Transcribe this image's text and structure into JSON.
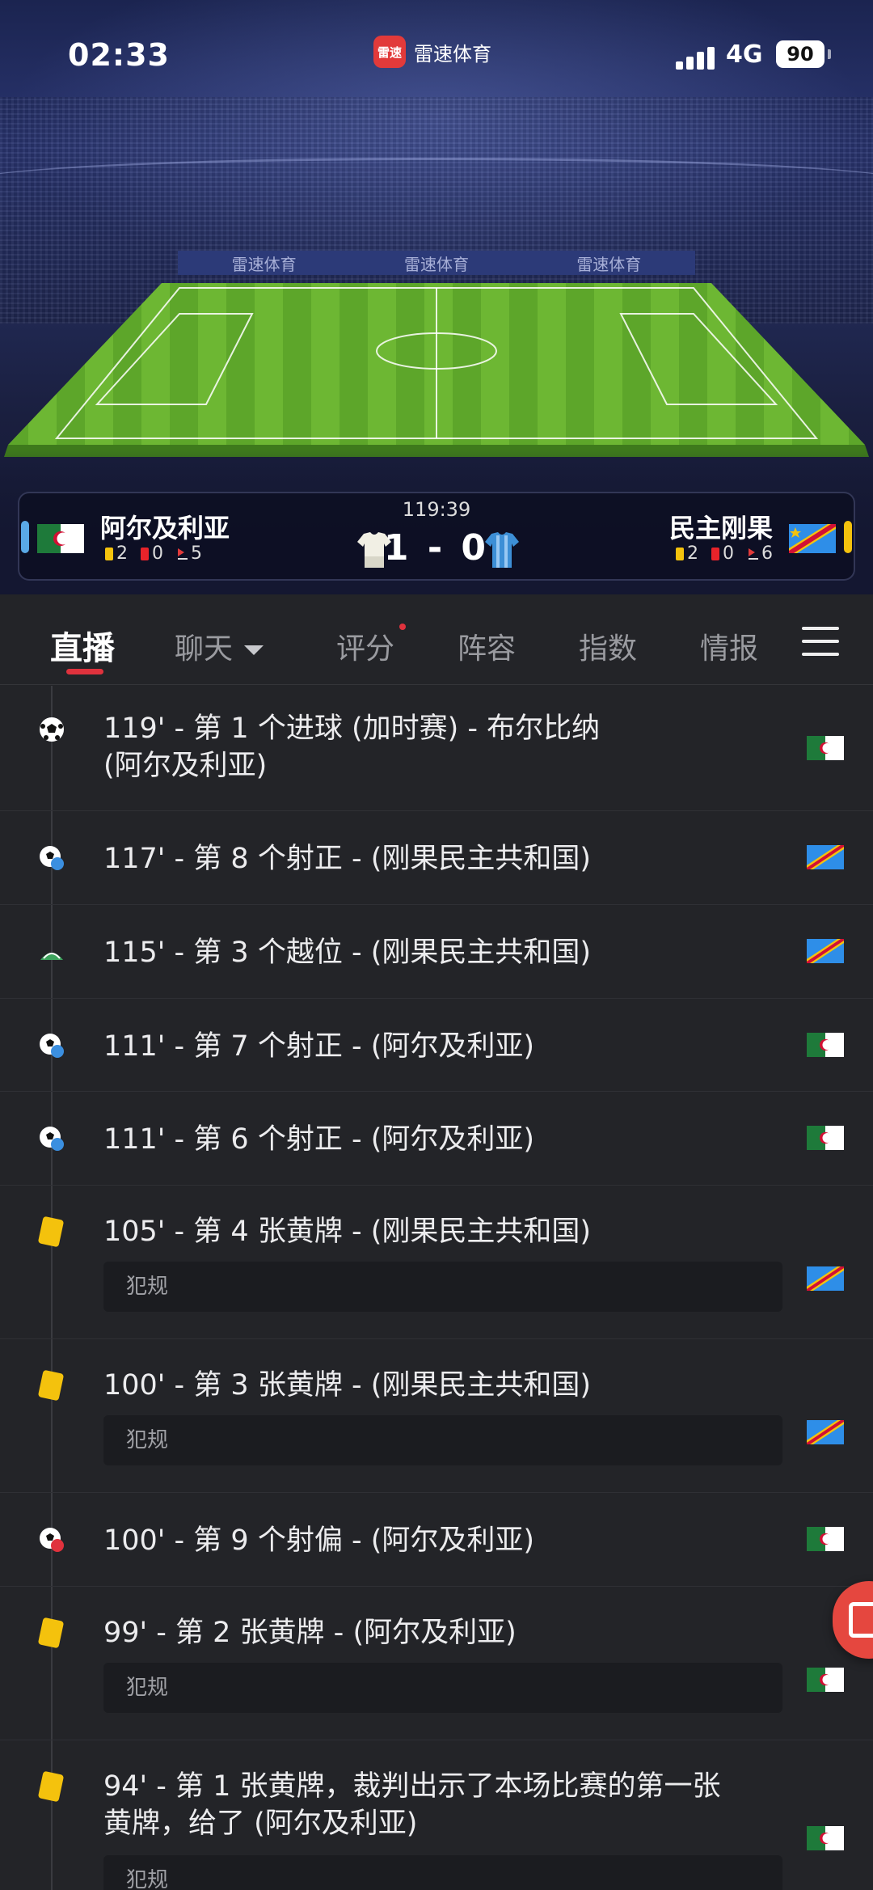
{
  "status_bar": {
    "time": "02:33",
    "app_logo_text": "雷速",
    "app_name": "雷速体育",
    "network": "4G",
    "battery": "90"
  },
  "stadium": {
    "ad_text": "雷速体育"
  },
  "match": {
    "clock": "119:39",
    "score": "1 - 0",
    "home": {
      "name": "阿尔及利亚",
      "yellow": "2",
      "red": "0",
      "corners": "5",
      "flag_icon": "algeria-flag",
      "accent": "#5aa9e6"
    },
    "away": {
      "name": "民主刚果",
      "yellow": "2",
      "red": "0",
      "corners": "6",
      "flag_icon": "dr-congo-flag",
      "accent": "#f4c20d"
    }
  },
  "tabs": [
    {
      "label": "直播",
      "active": true
    },
    {
      "label": "聊天"
    },
    {
      "label": "评分"
    },
    {
      "label": "阵容"
    },
    {
      "label": "指数"
    },
    {
      "label": "情报"
    }
  ],
  "events": [
    {
      "text_line1": "119' - 第 1 个进球 (加时赛) - 布尔比纳",
      "text_line2": "(阿尔及利亚)",
      "icon": "goal-ball-icon",
      "team": "algeria"
    },
    {
      "text_line1": "117' - 第 8 个射正 - (刚果民主共和国)",
      "icon": "shot-on-target-icon",
      "team": "congo"
    },
    {
      "text_line1": "115' - 第 3 个越位 - (刚果民主共和国)",
      "icon": "offside-icon",
      "team": "congo"
    },
    {
      "text_line1": "111' - 第 7 个射正 - (阿尔及利亚)",
      "icon": "shot-on-target-icon",
      "team": "algeria"
    },
    {
      "text_line1": "111' - 第 6 个射正 - (阿尔及利亚)",
      "icon": "shot-on-target-icon",
      "team": "algeria"
    },
    {
      "text_line1": "105' - 第 4 张黄牌 - (刚果民主共和国)",
      "detail": "犯规",
      "icon": "yellow-card-icon",
      "team": "congo"
    },
    {
      "text_line1": "100' - 第 3 张黄牌 - (刚果民主共和国)",
      "detail": "犯规",
      "icon": "yellow-card-icon",
      "team": "congo"
    },
    {
      "text_line1": "100' - 第 9 个射偏 - (阿尔及利亚)",
      "icon": "shot-off-target-icon",
      "team": "algeria"
    },
    {
      "text_line1": "99' - 第 2 张黄牌 - (阿尔及利亚)",
      "detail": "犯规",
      "icon": "yellow-card-icon",
      "team": "algeria"
    },
    {
      "text_line1": "94' - 第 1 张黄牌，裁判出示了本场比赛的第一张",
      "text_line2": "黄牌，给了 (阿尔及利亚)",
      "detail": "犯规",
      "icon": "yellow-card-icon",
      "team": "algeria"
    }
  ],
  "colors": {
    "accent_red": "#e0323d",
    "yellow_card": "#f4c20d",
    "background": "#232428"
  }
}
